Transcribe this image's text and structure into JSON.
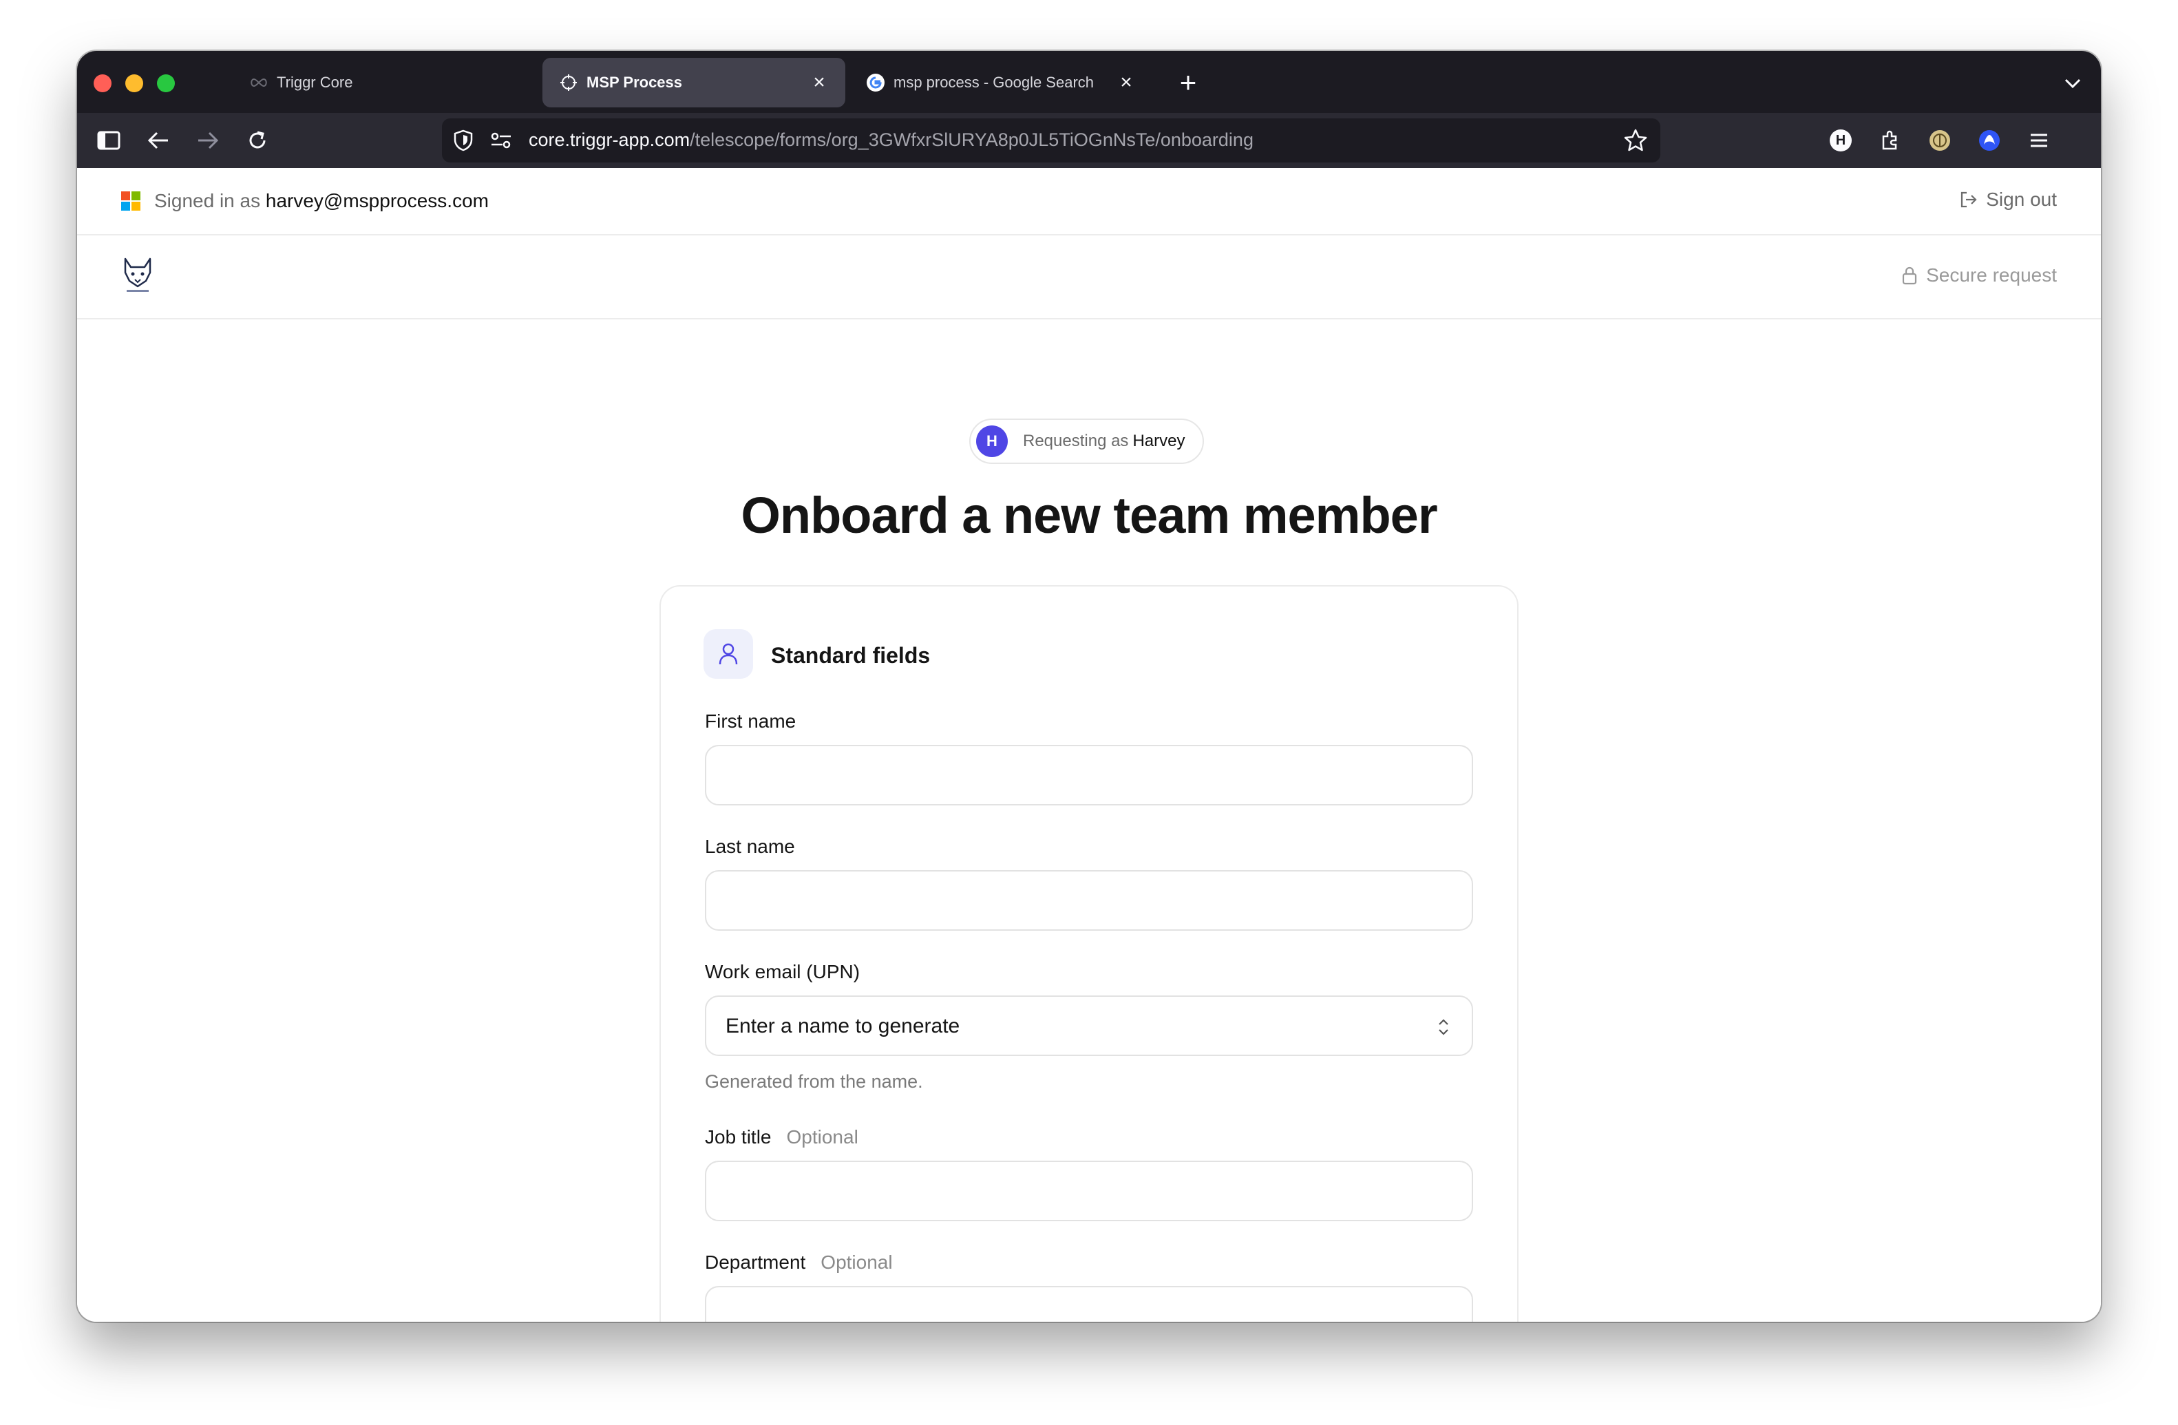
{
  "browser": {
    "tabs": [
      {
        "label": "Triggr Core",
        "active": false
      },
      {
        "label": "MSP Process",
        "active": true
      },
      {
        "label": "msp process - Google Search",
        "active": false
      }
    ],
    "url_host": "core.triggr-app.com",
    "url_path": "/telescope/forms/org_3GWfxrSlURYA8p0JL5TiOGnNsTe/onboarding",
    "extension_badge": "H"
  },
  "auth": {
    "signed_in_prefix": "Signed in as",
    "email": "harvey@mspprocess.com",
    "sign_out_label": "Sign out"
  },
  "header": {
    "secure_label": "Secure request"
  },
  "requester": {
    "initial": "H",
    "prefix": "Requesting as",
    "name": "Harvey"
  },
  "page": {
    "title": "Onboard a new team member"
  },
  "form": {
    "section_title": "Standard fields",
    "fields": [
      {
        "label": "First name",
        "optional": "",
        "value": ""
      },
      {
        "label": "Last name",
        "optional": "",
        "value": ""
      },
      {
        "label": "Work email (UPN)",
        "optional": "",
        "value": "Enter a name to generate",
        "hint": "Generated from the name."
      },
      {
        "label": "Job title",
        "optional": "Optional",
        "value": ""
      },
      {
        "label": "Department",
        "optional": "Optional",
        "value": ""
      }
    ]
  },
  "colors": {
    "accent": "#4f46e5",
    "tabbar": "#1c1b22",
    "navbar": "#2b2a33"
  }
}
